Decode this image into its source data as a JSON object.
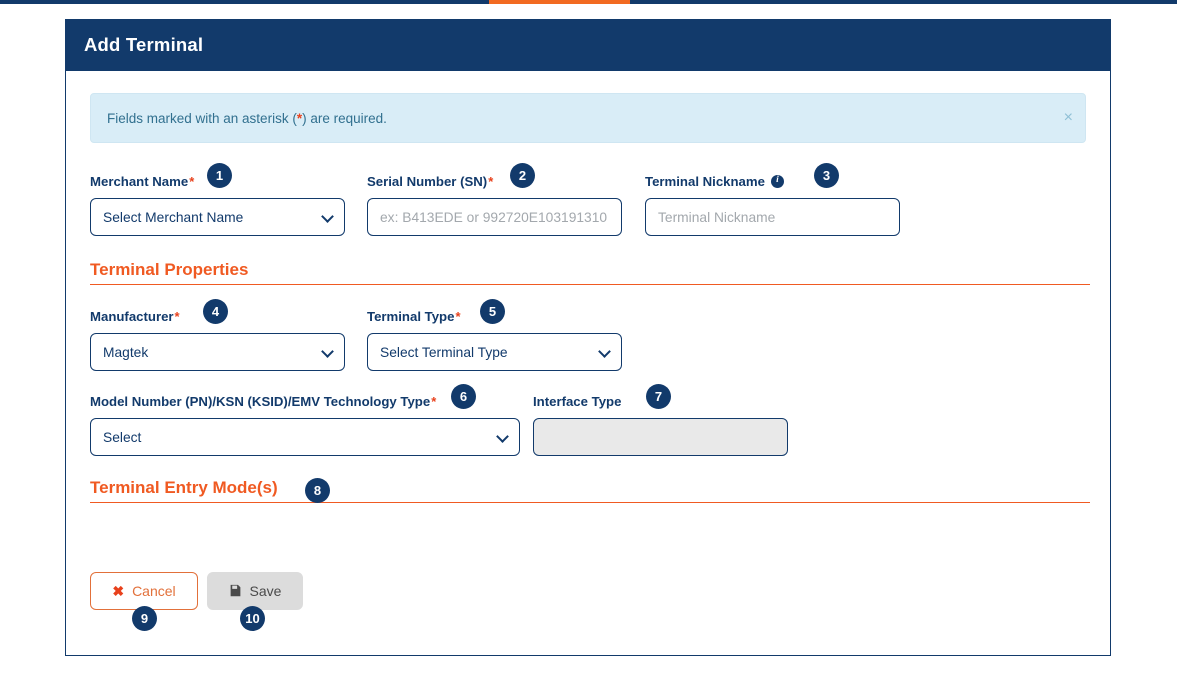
{
  "topbar": {
    "accent_color": "#f26a21",
    "bar_color": "#123a6b"
  },
  "header": {
    "title": "Add Terminal"
  },
  "alert": {
    "text_before": "Fields marked with an asterisk (",
    "asterisk": "*",
    "text_after": ") are required.",
    "close_label": "×"
  },
  "fields": {
    "merchant_name": {
      "label": "Merchant Name",
      "required_marker": "*",
      "value": "Select Merchant Name",
      "badge": "1"
    },
    "serial_number": {
      "label": "Serial Number (SN)",
      "required_marker": "*",
      "placeholder": "ex: B413EDE or 992720E103191310",
      "value": "",
      "badge": "2"
    },
    "terminal_nickname": {
      "label": "Terminal Nickname",
      "info_icon": "info-icon",
      "info_glyph": "i",
      "placeholder": "Terminal Nickname",
      "value": "",
      "badge": "3"
    },
    "manufacturer": {
      "label": "Manufacturer",
      "required_marker": "*",
      "value": "Magtek",
      "badge": "4"
    },
    "terminal_type": {
      "label": "Terminal Type",
      "required_marker": "*",
      "value": "Select Terminal Type",
      "badge": "5"
    },
    "model_number": {
      "label": "Model Number (PN)/KSN (KSID)/EMV Technology Type",
      "required_marker": "*",
      "value": "Select",
      "badge": "6"
    },
    "interface_type": {
      "label": "Interface Type",
      "value": "",
      "placeholder": "",
      "badge": "7"
    }
  },
  "sections": {
    "terminal_properties": {
      "title": "Terminal Properties"
    },
    "terminal_entry_modes": {
      "title": "Terminal Entry Mode(s)",
      "badge": "8"
    }
  },
  "buttons": {
    "cancel": {
      "label": "Cancel",
      "icon": "close-x-icon",
      "glyph": "✖",
      "badge": "9"
    },
    "save": {
      "label": "Save",
      "icon": "floppy-disk-icon",
      "glyph": "💾",
      "badge": "10"
    }
  },
  "colors": {
    "navy": "#123a6b",
    "orange": "#f05a22",
    "required_red": "#e8411c",
    "alert_bg": "#d9edf7",
    "disabled_bg": "#e9e9e9"
  }
}
